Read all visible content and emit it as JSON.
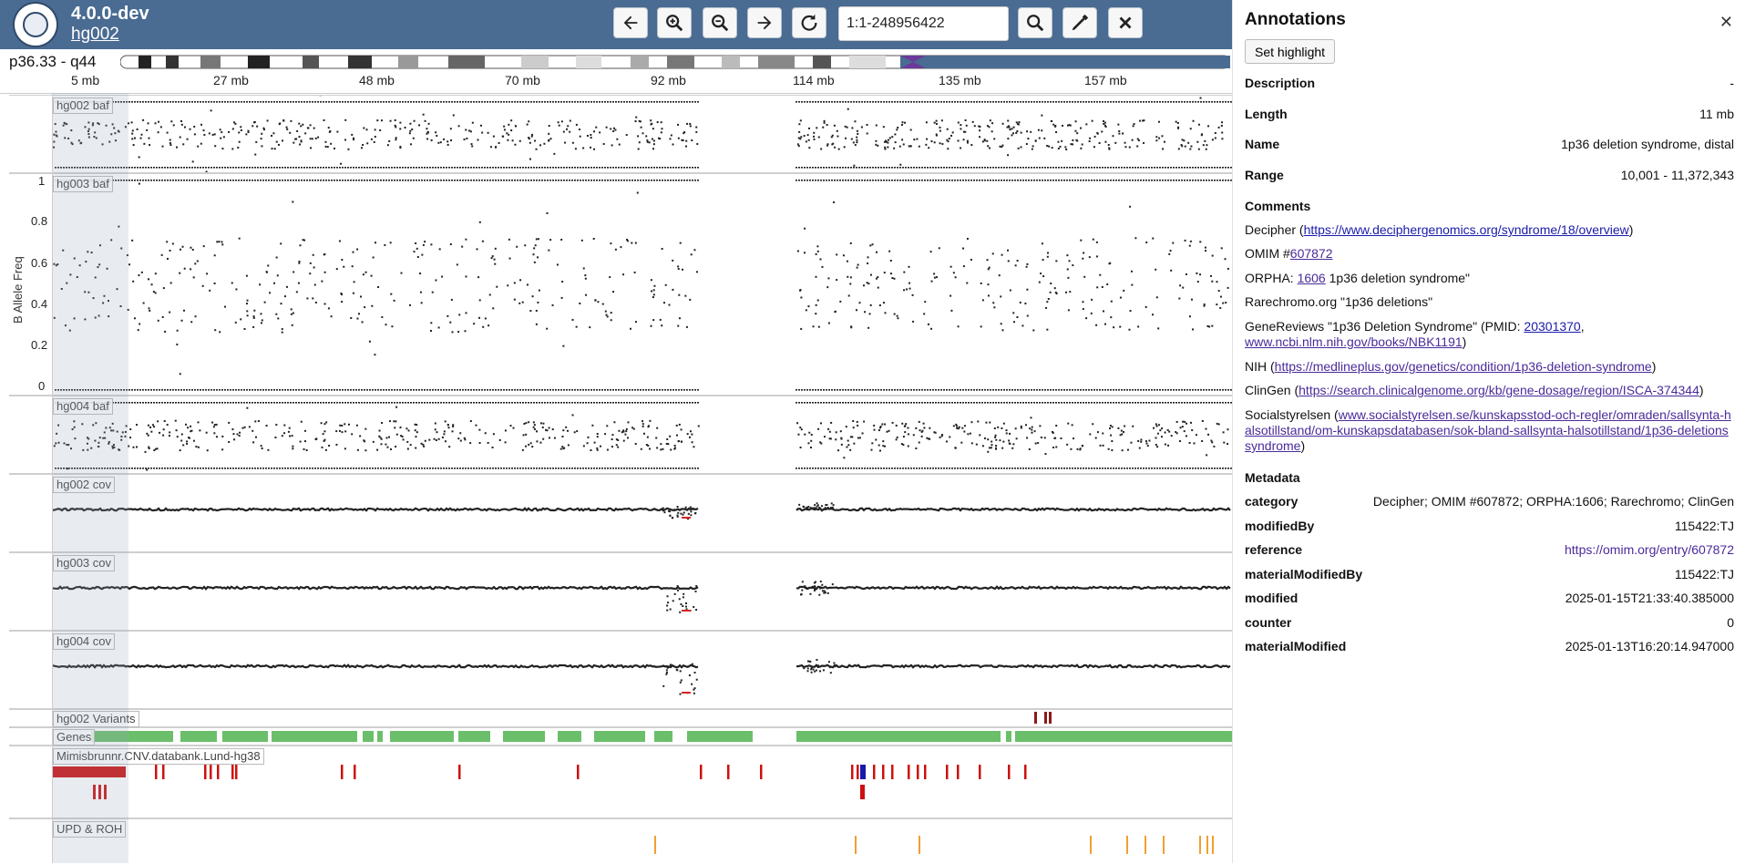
{
  "app": {
    "version": "4.0.0-dev",
    "genome": "hg002"
  },
  "toolbar": {
    "region_value": "1:1-248956422",
    "icons": [
      "arrow-left-icon",
      "zoom-in-icon",
      "zoom-out-icon",
      "arrow-right-icon",
      "reset-icon",
      "search-icon",
      "highlighter-icon",
      "close-icon"
    ]
  },
  "ideogram": {
    "band_label": "p36.33 - q44"
  },
  "axis": {
    "ticks": [
      "5 mb",
      "27 mb",
      "48 mb",
      "70 mb",
      "92 mb",
      "114 mb",
      "135 mb",
      "157 mb"
    ]
  },
  "tracks": {
    "baf": [
      "hg002 baf",
      "hg003 baf",
      "hg004 baf"
    ],
    "cov": [
      "hg002 cov",
      "hg003 cov",
      "hg004 cov"
    ],
    "variants": "hg002 Variants",
    "genes": "Genes",
    "mimisbrunnr": "Mimisbrunnr.CNV.databank.Lund-hg38",
    "upd": "UPD & ROH",
    "y_axis_title": "B Allele Freq",
    "y_ticks": [
      "1",
      "0.8",
      "0.6",
      "0.4",
      "0.2",
      "0"
    ]
  },
  "colors": {
    "header": "#4a6b92",
    "variant": "#8b1a1a",
    "gene": "#6bbf6b",
    "cnv_red": "#cc1111",
    "cnv_blue": "#1a1aaa",
    "upd": "#f0a030",
    "link": "#4a2b9a"
  },
  "panel": {
    "title": "Annotations",
    "highlight_label": "Set highlight",
    "fields": [
      {
        "key": "Description",
        "value": "-"
      },
      {
        "key": "Length",
        "value": "11 mb"
      },
      {
        "key": "Name",
        "value": "1p36 deletion syndrome, distal"
      },
      {
        "key": "Range",
        "value": "10,001 - 11,372,343"
      }
    ],
    "comments_heading": "Comments",
    "comments": {
      "decipher_prefix": "Decipher (",
      "decipher_url": "https://www.deciphergenomics.org/syndrome/18/overview",
      "decipher_suffix": ")",
      "omim_prefix": "OMIM #",
      "omim_id": "607872",
      "orpha_prefix": "ORPHA: ",
      "orpha_id": "1606",
      "orpha_suffix": " 1p36 deletion syndrome\"",
      "rarechromo": "Rarechromo.org \"1p36 deletions\"",
      "genereviews_prefix": "GeneReviews \"1p36 Deletion Syndrome\" (PMID: ",
      "genereviews_pmid": "20301370",
      "genereviews_sep": ", ",
      "genereviews_url": "www.ncbi.nlm.nih.gov/books/NBK1191",
      "genereviews_suffix": ")",
      "nih_prefix": "NIH (",
      "nih_url": "https://medlineplus.gov/genetics/condition/1p36-deletion-syndrome",
      "nih_suffix": ")",
      "clingen_prefix": "ClinGen (",
      "clingen_url": "https://search.clinicalgenome.org/kb/gene-dosage/region/ISCA-374344",
      "clingen_suffix": ")",
      "social_prefix": "Socialstyrelsen (",
      "social_url": "www.socialstyrelsen.se/kunskapsstod-och-regler/omraden/sallsynta-halsotillstand/om-kunskapsdatabasen/sok-bland-sallsynta-halsotillstand/1p36-deletionssyndrome",
      "social_suffix": ")"
    },
    "metadata_heading": "Metadata",
    "metadata": [
      {
        "key": "category",
        "value": "Decipher; OMIM #607872; ORPHA:1606; Rarechromo; ClinGen"
      },
      {
        "key": "modifiedBy",
        "value": "115422:TJ"
      },
      {
        "key": "reference",
        "value": "https://omim.org/entry/607872"
      },
      {
        "key": "materialModifiedBy",
        "value": "115422:TJ"
      },
      {
        "key": "modified",
        "value": "2025-01-15T21:33:40.385000"
      },
      {
        "key": "counter",
        "value": "0"
      },
      {
        "key": "materialModified",
        "value": "2025-01-13T16:20:14.947000"
      }
    ]
  }
}
